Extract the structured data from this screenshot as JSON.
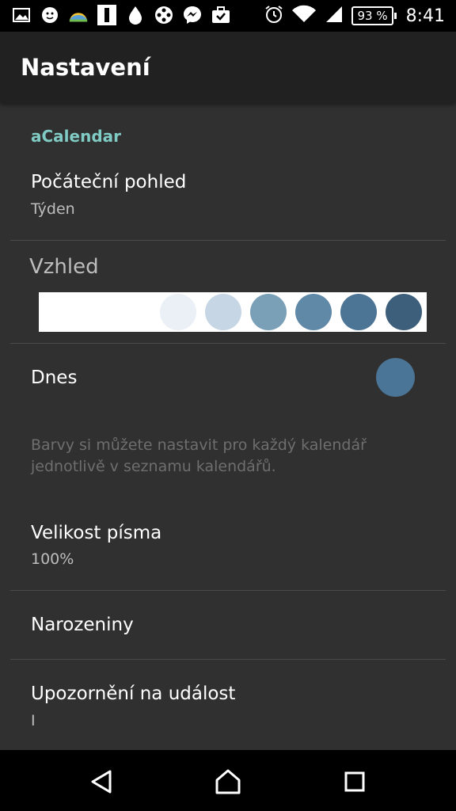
{
  "status_bar": {
    "icons": [
      "gallery-icon",
      "avatar-icon",
      "weather-icon",
      "news-icon",
      "drop-icon",
      "film-icon",
      "messenger-icon",
      "task-icon"
    ],
    "battery": "93 %",
    "time": "8:41"
  },
  "app_bar": {
    "title": "Nastavení"
  },
  "settings": {
    "category": "aCalendar",
    "start_view": {
      "title": "Počáteční pohled",
      "summary": "Týden"
    },
    "appearance": {
      "title": "Vzhled",
      "swatches": [
        "#ffffff",
        "#eaf0f6",
        "#c6d6e4",
        "#7aa0b8",
        "#5f89a7",
        "#4c7495",
        "#3e5f7b"
      ]
    },
    "today": {
      "title": "Dnes",
      "color": "#4b7597"
    },
    "hint": "Barvy si můžete nastavit pro každý kalendář jednotlivě v seznamu kalendářů.",
    "font_size": {
      "title": "Velikost písma",
      "summary": "100%"
    },
    "birthdays": {
      "title": "Narozeniny"
    },
    "event_alert": {
      "title": "Upozornění na událost",
      "summary": "I"
    }
  },
  "nav_bar": {
    "back": "back-icon",
    "home": "home-icon",
    "recents": "recents-icon"
  }
}
